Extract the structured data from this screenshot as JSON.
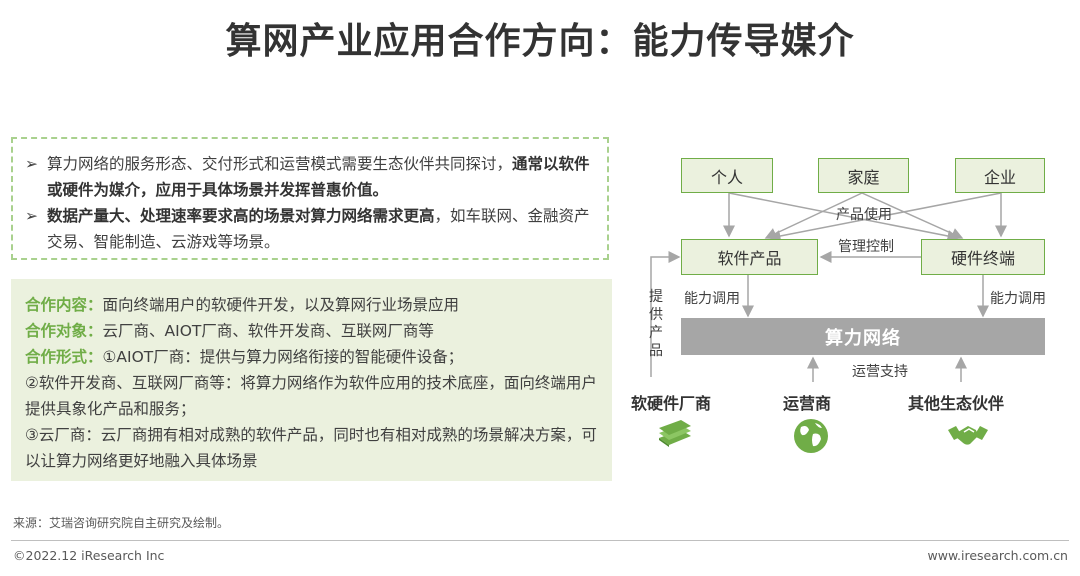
{
  "title": "算网产业应用合作方向：能力传导媒介",
  "intro": {
    "bullets": [
      {
        "normal": "算力网络的服务形态、交付形式和运营模式需要生态伙伴共同探讨，",
        "bold": "通常以软件或硬件为媒介，应用于具体场景并发挥普惠价值。",
        "tail": ""
      },
      {
        "normal": "",
        "bold": "数据产量大、处理速率要求高的场景对算力网络需求更高",
        "tail": "，如车联网、金融资产交易、智能制造、云游戏等场景。"
      }
    ]
  },
  "cooperation": {
    "content_label": "合作内容：",
    "content_text": "面向终端用户的软硬件开发，以及算网行业场景应用",
    "target_label": "合作对象：",
    "target_text": "云厂商、AIOT厂商、软件开发商、互联网厂商等",
    "form_label": "合作形式：",
    "form_line1": "①AIOT厂商：提供与算力网络衔接的智能硬件设备；",
    "form_line2": "②软件开发商、互联网厂商等：将算力网络作为软件应用的技术底座，面向终端用户提供具象化产品和服务；",
    "form_line3": "③云厂商：云厂商拥有相对成熟的软件产品，同时也有相对成熟的场景解决方案，可以让算力网络更好地融入具体场景"
  },
  "diagram": {
    "users": [
      "个人",
      "家庭",
      "企业"
    ],
    "software": "软件产品",
    "hardware": "硬件终端",
    "network": "算力网络",
    "label_usage": "产品使用",
    "label_control": "管理控制",
    "label_call_left": "能力调用",
    "label_call_right": "能力调用",
    "label_provide": "提供产品",
    "label_ops": "运营支持",
    "partners": [
      "软硬件厂商",
      "运营商",
      "其他生态伙伴"
    ],
    "icons": [
      "books-icon",
      "globe-icon",
      "handshake-icon"
    ],
    "accent": "#70ad47",
    "arrow_color": "#a6a6a6"
  },
  "source": "来源：艾瑞咨询研究院自主研究及绘制。",
  "footer_left": "©2022.12 iResearch Inc",
  "footer_right": "www.iresearch.com.cn"
}
